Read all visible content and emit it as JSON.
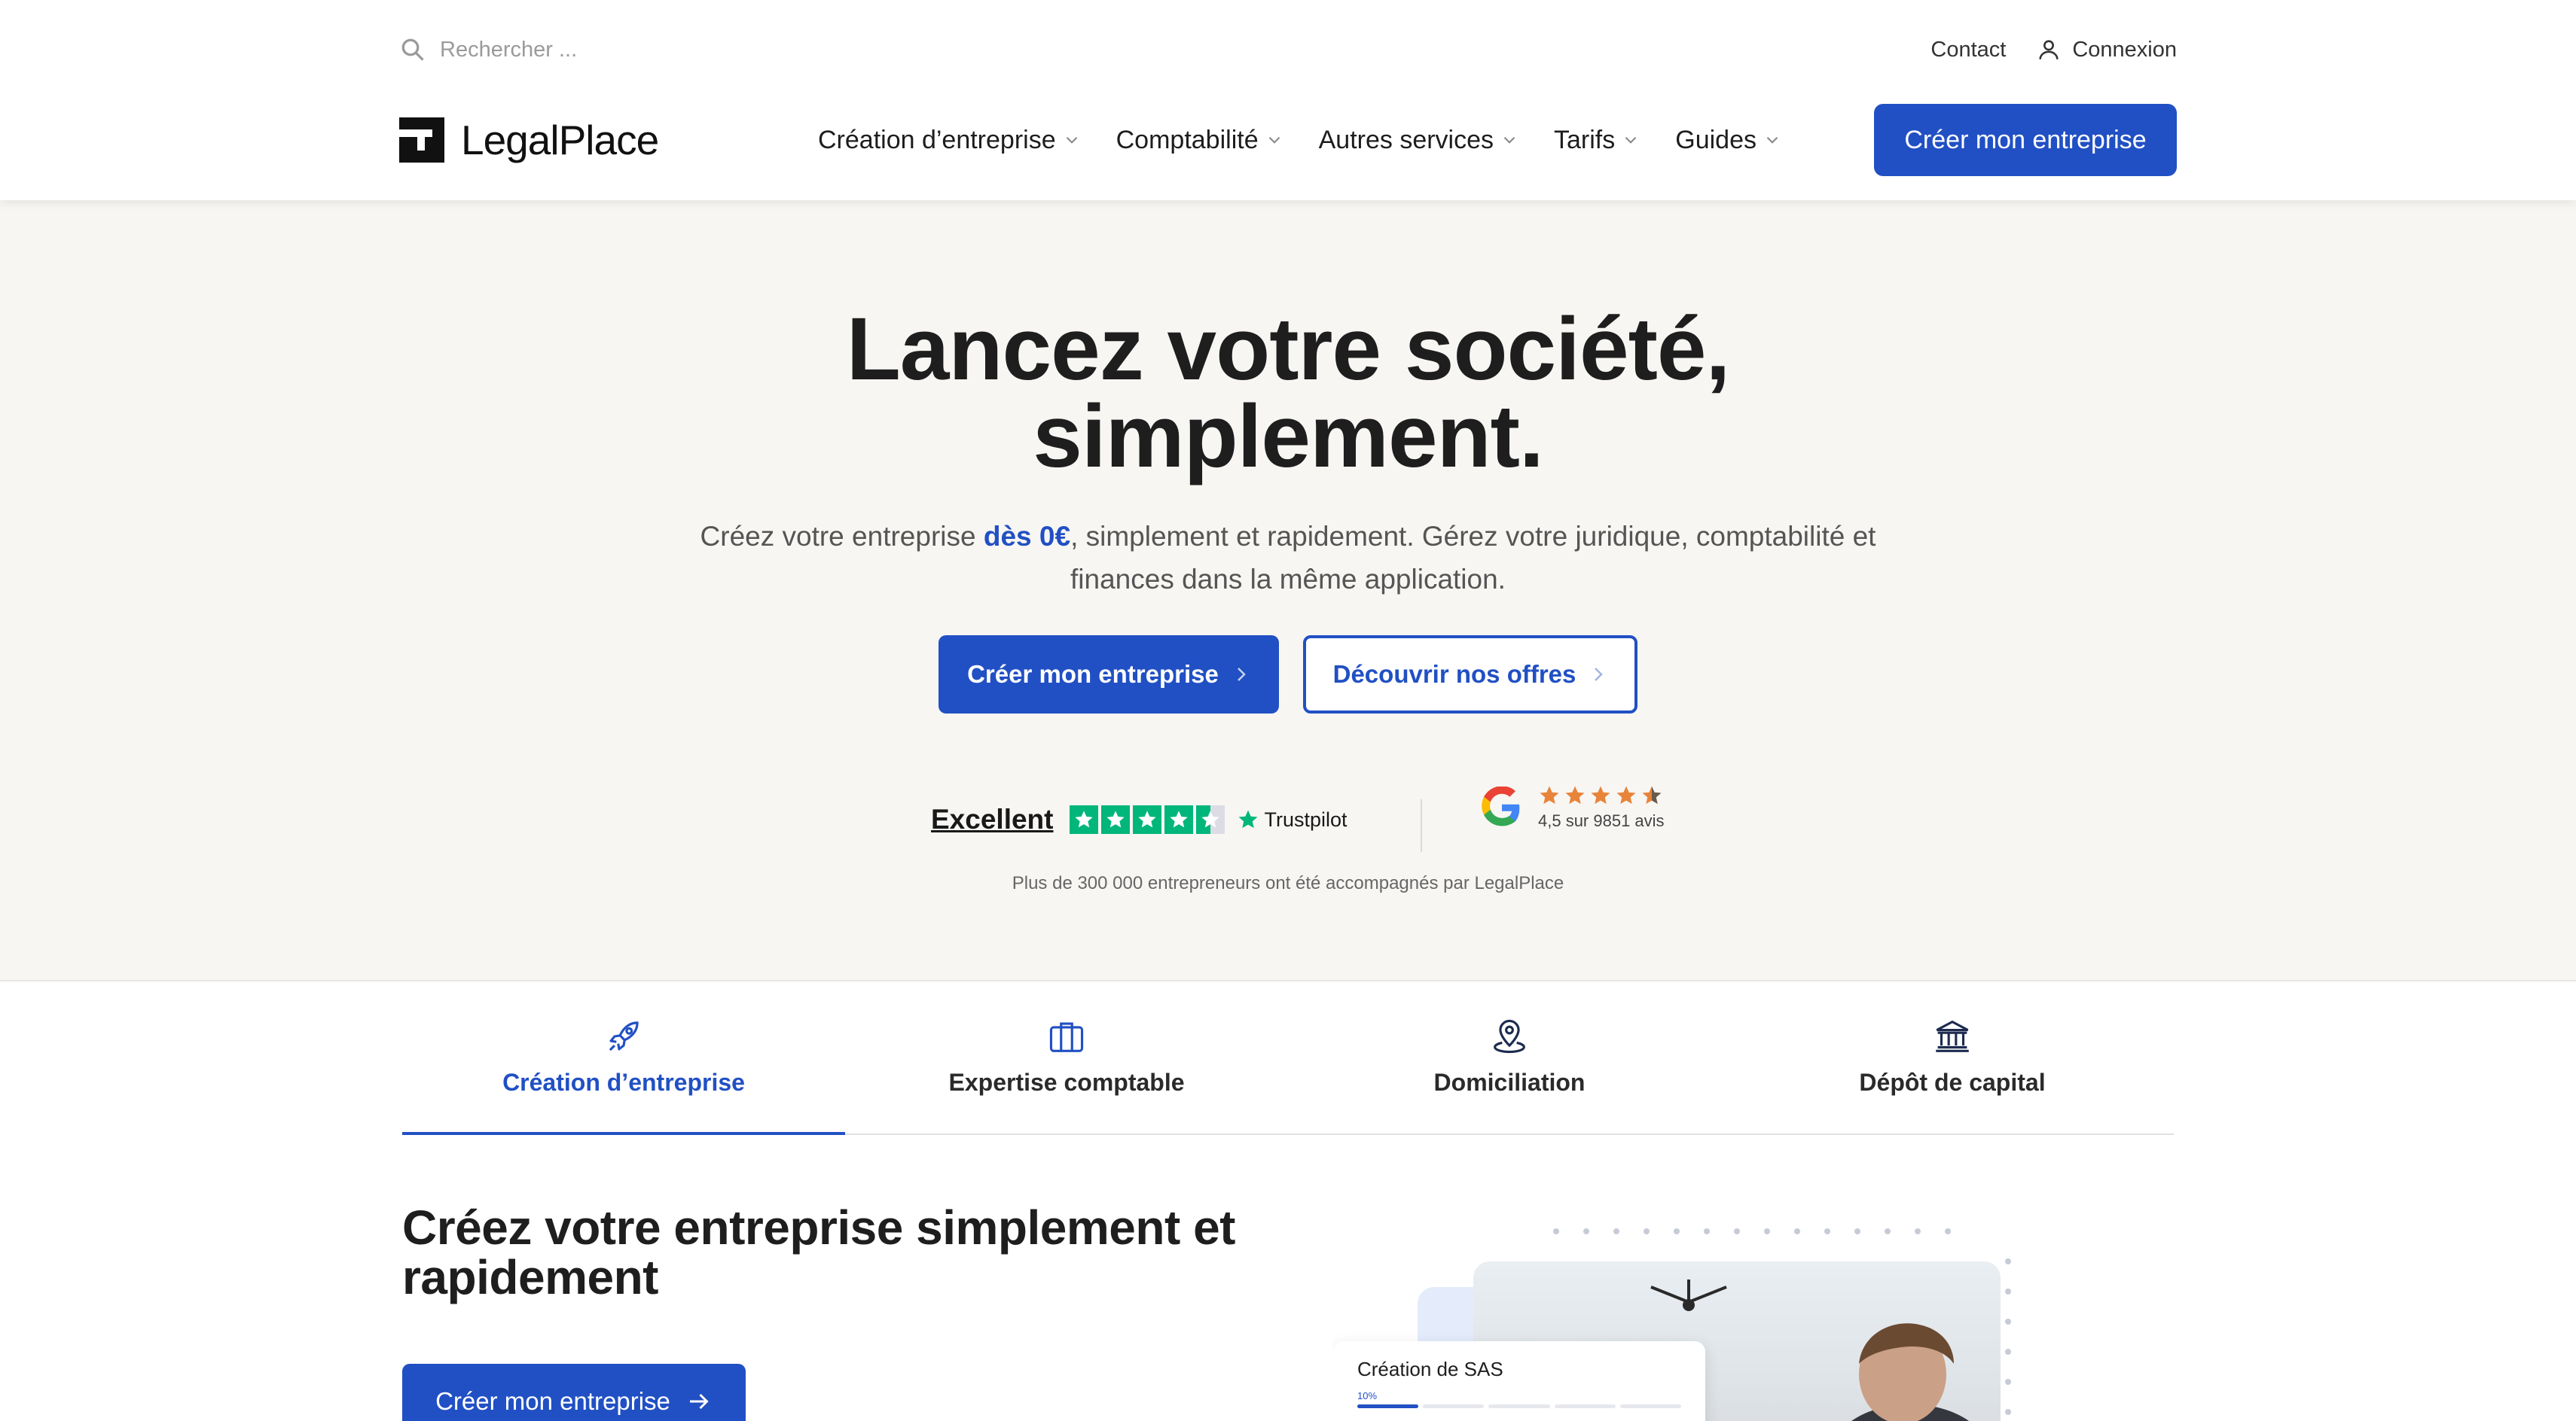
{
  "header": {
    "search": {
      "placeholder": "Rechercher ...",
      "icon": "search-icon"
    },
    "contact_label": "Contact",
    "login_label": "Connexion",
    "logo_text": "LegalPlace",
    "nav": [
      {
        "label": "Création d’entreprise"
      },
      {
        "label": "Comptabilité"
      },
      {
        "label": "Autres services"
      },
      {
        "label": "Tarifs"
      },
      {
        "label": "Guides"
      }
    ],
    "cta_label": "Créer mon entreprise"
  },
  "hero": {
    "title_line1": "Lancez votre société,",
    "title_line2": "simplement.",
    "subtitle_before": "Créez votre entreprise ",
    "subtitle_highlight": "dès 0€",
    "subtitle_after": ", simplement et rapidement. Gérez votre juridique, comptabilité et finances dans la même application.",
    "primary_button": "Créer mon entreprise",
    "secondary_button": "Découvrir nos offres",
    "trustpilot": {
      "label": "Excellent",
      "brand": "Trustpilot",
      "stars": 4.5
    },
    "google": {
      "rating_text": "4,5 sur 9851 avis",
      "stars": 4.5
    },
    "note": "Plus de 300 000 entrepreneurs ont été accompagnés par LegalPlace"
  },
  "tabs": [
    {
      "label": "Création d’entreprise",
      "icon": "rocket-icon",
      "active": true
    },
    {
      "label": "Expertise comptable",
      "icon": "briefcase-icon",
      "active": false
    },
    {
      "label": "Domiciliation",
      "icon": "location-pin-icon",
      "active": false
    },
    {
      "label": "Dépôt de capital",
      "icon": "bank-icon",
      "active": false
    }
  ],
  "section": {
    "title": "Créez votre entreprise simplement et rapidement",
    "cta_label": "Créer mon entreprise",
    "card": {
      "title": "Création de SAS",
      "progress_label": "10%",
      "progress": 0.1
    }
  },
  "colors": {
    "brand_blue": "#2150c4",
    "hero_bg": "#f8f6f3",
    "trustpilot_green": "#00b67a",
    "google_star": "#e8843a"
  }
}
